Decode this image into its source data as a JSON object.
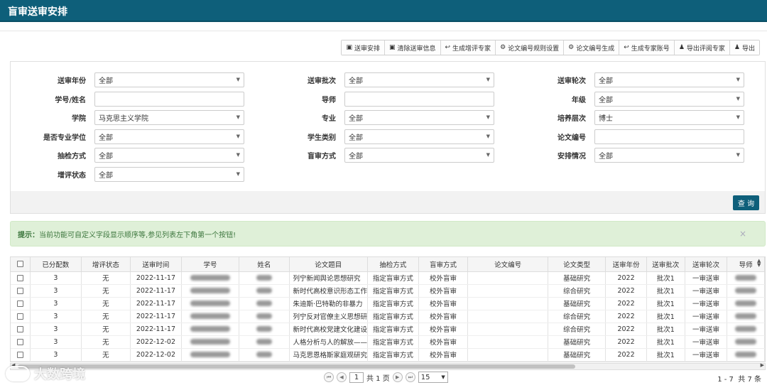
{
  "header": {
    "title": "盲审送审安排"
  },
  "toolbar": {
    "buttons": [
      {
        "icon": "save-icon",
        "label": "送审安排"
      },
      {
        "icon": "save-icon",
        "label": "清除送审信息"
      },
      {
        "icon": "export-icon",
        "label": "生成增评专家"
      },
      {
        "icon": "gear-icon",
        "label": "论文编号规则设置"
      },
      {
        "icon": "gear-icon",
        "label": "论文编号生成"
      },
      {
        "icon": "export-icon",
        "label": "生成专家账号"
      },
      {
        "icon": "user-export-icon",
        "label": "导出评阅专家"
      },
      {
        "icon": "user-export-icon",
        "label": "导出"
      }
    ]
  },
  "filters": {
    "review_year": {
      "label": "送审年份",
      "value": "全部"
    },
    "review_batch": {
      "label": "送审批次",
      "value": "全部"
    },
    "review_round": {
      "label": "送审轮次",
      "value": "全部"
    },
    "student_id_name": {
      "label": "学号/姓名",
      "value": ""
    },
    "advisor": {
      "label": "导师",
      "value": ""
    },
    "grade": {
      "label": "年级",
      "value": "全部"
    },
    "college": {
      "label": "学院",
      "value": "马克思主义学院"
    },
    "major": {
      "label": "专业",
      "value": "全部"
    },
    "level": {
      "label": "培养层次",
      "value": "博士"
    },
    "professional_degree": {
      "label": "是否专业学位",
      "value": "全部"
    },
    "student_type": {
      "label": "学生类别",
      "value": "全部"
    },
    "thesis_no": {
      "label": "论文编号",
      "value": ""
    },
    "sampling": {
      "label": "抽检方式",
      "value": "全部"
    },
    "blind_method": {
      "label": "盲审方式",
      "value": "全部"
    },
    "arrangement": {
      "label": "安排情况",
      "value": "全部"
    },
    "extra_review": {
      "label": "增评状态",
      "value": "全部"
    }
  },
  "query_label": "查 询",
  "hint": {
    "label": "提示：",
    "text": "当前功能可自定义字段显示顺序等,参见列表左下角第一个按钮!",
    "close": "×"
  },
  "table": {
    "columns": [
      "已分配数",
      "增评状态",
      "送审时间",
      "学号",
      "姓名",
      "论文题目",
      "抽检方式",
      "盲审方式",
      "论文编号",
      "论文类型",
      "送审年份",
      "送审批次",
      "送审轮次",
      "导师"
    ],
    "rows": [
      [
        "3",
        "无",
        "2022-11-17",
        "",
        "",
        "列宁新闻舆论思想研究",
        "指定盲审方式",
        "校外盲审",
        "",
        "基础研究",
        "2022",
        "批次1",
        "一审送审",
        ""
      ],
      [
        "3",
        "无",
        "2022-11-17",
        "",
        "",
        "新时代高校意识形态工作",
        "指定盲审方式",
        "校外盲审",
        "",
        "综合研究",
        "2022",
        "批次1",
        "一审送审",
        ""
      ],
      [
        "3",
        "无",
        "2022-11-17",
        "",
        "",
        "朱迪斯·巴特勒的非暴力",
        "指定盲审方式",
        "校外盲审",
        "",
        "基础研究",
        "2022",
        "批次1",
        "一审送审",
        ""
      ],
      [
        "3",
        "无",
        "2022-11-17",
        "",
        "",
        "列宁反对官僚主义思想研",
        "指定盲审方式",
        "校外盲审",
        "",
        "综合研究",
        "2022",
        "批次1",
        "一审送审",
        ""
      ],
      [
        "3",
        "无",
        "2022-11-17",
        "",
        "",
        "新时代高校党建文化建设",
        "指定盲审方式",
        "校外盲审",
        "",
        "综合研究",
        "2022",
        "批次1",
        "一审送审",
        ""
      ],
      [
        "3",
        "无",
        "2022-12-02",
        "",
        "",
        "人格分析与人的解放——",
        "指定盲审方式",
        "校外盲审",
        "",
        "基础研究",
        "2022",
        "批次1",
        "一审送审",
        ""
      ],
      [
        "3",
        "无",
        "2022-12-02",
        "",
        "",
        "马克思恩格斯家庭观研究",
        "指定盲审方式",
        "校外盲审",
        "",
        "基础研究",
        "2022",
        "批次1",
        "一审送审",
        ""
      ]
    ]
  },
  "pager": {
    "page": "1",
    "total_pages_text": "共 1 页",
    "page_size": "15",
    "range_text": "1 - 7",
    "total_text": "共 7 条"
  },
  "watermark": {
    "text": "大数跨境"
  }
}
